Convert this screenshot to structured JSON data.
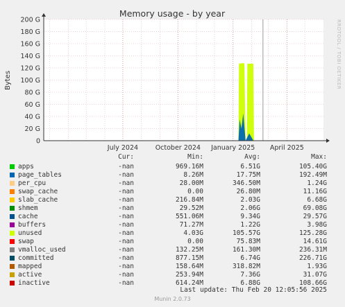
{
  "chart_data": {
    "type": "area",
    "title": "Memory usage - by year",
    "ylabel": "Bytes",
    "ylim": [
      0,
      200
    ],
    "y_unit": "G",
    "yticks": [
      "0",
      "20 G",
      "40 G",
      "60 G",
      "80 G",
      "100 G",
      "120 G",
      "140 G",
      "160 G",
      "180 G",
      "200 G"
    ],
    "x_tick_labels": [
      {
        "date": "2024-07-01",
        "label": "July 2024"
      },
      {
        "date": "2024-10-01",
        "label": "October 2024"
      },
      {
        "date": "2025-01-01",
        "label": "January 2025"
      },
      {
        "date": "2025-04-01",
        "label": "April 2025"
      }
    ],
    "xlim": [
      "2024-02-20",
      "2025-06-01"
    ],
    "grid": true,
    "series": [
      {
        "name": "apps",
        "color": "#00cc00",
        "points": [
          [
            "2025-01-10",
            0
          ],
          [
            "2025-01-12",
            30
          ],
          [
            "2025-01-14",
            10
          ],
          [
            "2025-01-16",
            25
          ],
          [
            "2025-01-18",
            40
          ],
          [
            "2025-01-20",
            12
          ],
          [
            "2025-01-22",
            0
          ],
          [
            "2025-01-26",
            0
          ],
          [
            "2025-01-28",
            8
          ],
          [
            "2025-02-01",
            10
          ],
          [
            "2025-02-05",
            0
          ]
        ]
      },
      {
        "name": "unused",
        "color": "#ccff00",
        "points": [
          [
            "2025-01-10",
            0
          ],
          [
            "2025-01-11",
            127
          ],
          [
            "2025-01-18",
            128
          ],
          [
            "2025-01-20",
            127
          ],
          [
            "2025-01-22",
            0
          ],
          [
            "2025-01-24",
            0
          ],
          [
            "2025-01-25",
            127
          ],
          [
            "2025-02-04",
            127
          ],
          [
            "2025-02-05",
            0
          ]
        ]
      },
      {
        "name": "cache",
        "color": "#0066b3",
        "points": [
          [
            "2025-01-10",
            0
          ],
          [
            "2025-01-12",
            35
          ],
          [
            "2025-01-15",
            20
          ],
          [
            "2025-01-18",
            45
          ],
          [
            "2025-01-22",
            0
          ],
          [
            "2025-01-28",
            12
          ],
          [
            "2025-02-04",
            0
          ]
        ]
      }
    ],
    "marker_date": "2025-02-20"
  },
  "legend": {
    "headers": {
      "cur": "Cur:",
      "min": "Min:",
      "avg": "Avg:",
      "max": "Max:"
    },
    "rows": [
      {
        "name": "apps",
        "color": "#00cc00",
        "cur": "-nan",
        "min": "969.16M",
        "avg": "6.51G",
        "max": "105.40G"
      },
      {
        "name": "page_tables",
        "color": "#0066b3",
        "cur": "-nan",
        "min": "8.26M",
        "avg": "17.75M",
        "max": "192.49M"
      },
      {
        "name": "per_cpu",
        "color": "#ffcc88",
        "cur": "-nan",
        "min": "28.00M",
        "avg": "346.50M",
        "max": "1.24G"
      },
      {
        "name": "swap_cache",
        "color": "#ff8000",
        "cur": "-nan",
        "min": "0.00",
        "avg": "26.80M",
        "max": "11.16G"
      },
      {
        "name": "slab_cache",
        "color": "#ffcc00",
        "cur": "-nan",
        "min": "216.84M",
        "avg": "2.03G",
        "max": "6.68G"
      },
      {
        "name": "shmem",
        "color": "#008f00",
        "cur": "-nan",
        "min": "29.52M",
        "avg": "2.06G",
        "max": "69.08G"
      },
      {
        "name": "cache",
        "color": "#00528f",
        "cur": "-nan",
        "min": "551.06M",
        "avg": "9.34G",
        "max": "29.57G"
      },
      {
        "name": "buffers",
        "color": "#990099",
        "cur": "-nan",
        "min": "71.27M",
        "avg": "1.22G",
        "max": "3.98G"
      },
      {
        "name": "unused",
        "color": "#ccff00",
        "cur": "-nan",
        "min": "4.03G",
        "avg": "105.57G",
        "max": "125.28G"
      },
      {
        "name": "swap",
        "color": "#ff0000",
        "cur": "-nan",
        "min": "0.00",
        "avg": "75.83M",
        "max": "14.61G"
      },
      {
        "name": "vmalloc_used",
        "color": "#808080",
        "cur": "-nan",
        "min": "132.25M",
        "avg": "161.30M",
        "max": "236.31M"
      },
      {
        "name": "committed",
        "color": "#004d66",
        "cur": "-nan",
        "min": "877.15M",
        "avg": "6.74G",
        "max": "226.71G"
      },
      {
        "name": "mapped",
        "color": "#b35900",
        "cur": "-nan",
        "min": "158.64M",
        "avg": "318.82M",
        "max": "1.93G"
      },
      {
        "name": "active",
        "color": "#c8a000",
        "cur": "-nan",
        "min": "253.94M",
        "avg": "7.36G",
        "max": "31.07G"
      },
      {
        "name": "inactive",
        "color": "#cc0000",
        "cur": "-nan",
        "min": "614.24M",
        "avg": "6.88G",
        "max": "108.66G"
      }
    ]
  },
  "footer": {
    "last_update": "Last update: Thu Feb 20 12:05:56 2025",
    "munin_version": "Munin 2.0.73"
  },
  "side_label": "RRDTOOL / TOBI OETIKER"
}
